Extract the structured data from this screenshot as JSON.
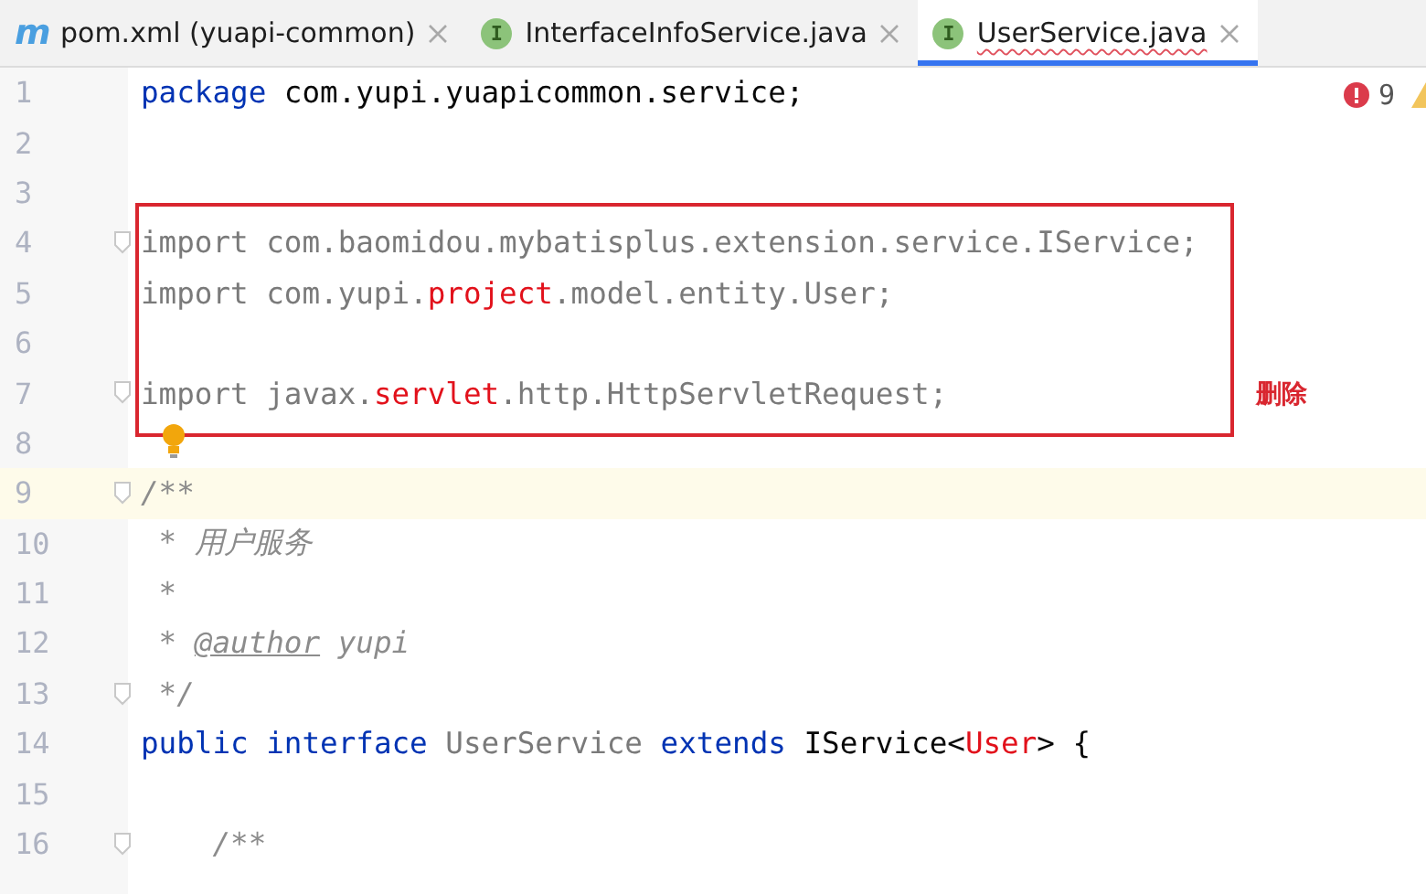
{
  "tabs": [
    {
      "badge": "m",
      "kind": "maven",
      "label": "pom.xml (yuapi-common)",
      "selected": false,
      "error": false
    },
    {
      "badge": "I",
      "kind": "interface",
      "label": "InterfaceInfoService.java",
      "selected": false,
      "error": false
    },
    {
      "badge": "I",
      "kind": "interface",
      "label": "UserService.java",
      "selected": true,
      "error": true
    }
  ],
  "inspection": {
    "errors": "9"
  },
  "lines": [
    {
      "kind": "line",
      "number": "1",
      "current": false,
      "fold": false,
      "tokens": [
        {
          "text": "package",
          "kind": "keyword"
        },
        {
          "text": " com.yupi.yuapicommon.service;",
          "kind": "plain"
        }
      ]
    },
    {
      "kind": "line",
      "number": "2",
      "current": false,
      "fold": false
    },
    {
      "kind": "line",
      "number": "3",
      "current": false,
      "fold": false
    },
    {
      "kind": "frame",
      "note": "删除",
      "children": [
        {
          "kind": "line",
          "number": "4",
          "current": false,
          "fold": true,
          "tokens": [
            {
              "text": "import com.baomidou.mybatisplus.extension.service.IService;",
              "kind": "unused"
            }
          ]
        },
        {
          "kind": "line",
          "number": "5",
          "current": false,
          "fold": false,
          "tokens": [
            {
              "text": "import com.yupi.",
              "kind": "unused"
            },
            {
              "text": "project",
              "kind": "error"
            },
            {
              "text": ".model.entity.User;",
              "kind": "unused"
            }
          ]
        },
        {
          "kind": "line",
          "number": "6",
          "current": false,
          "fold": false
        },
        {
          "kind": "line",
          "number": "7",
          "current": false,
          "fold": true,
          "tokens": [
            {
              "text": "import javax.",
              "kind": "unused"
            },
            {
              "text": "servlet",
              "kind": "error"
            },
            {
              "text": ".http.HttpServletRequest;",
              "kind": "unused"
            }
          ]
        }
      ]
    },
    {
      "kind": "line",
      "number": "8",
      "current": false,
      "fold": false,
      "bulb": true
    },
    {
      "kind": "line",
      "number": "9",
      "current": true,
      "fold": true,
      "tokens": [
        {
          "text": "/**",
          "kind": "comment"
        }
      ]
    },
    {
      "kind": "line",
      "number": "10",
      "current": false,
      "fold": false,
      "tokens": [
        {
          "text": " * 用户服务",
          "kind": "comment"
        }
      ]
    },
    {
      "kind": "line",
      "number": "11",
      "current": false,
      "fold": false,
      "tokens": [
        {
          "text": " *",
          "kind": "comment"
        }
      ]
    },
    {
      "kind": "line",
      "number": "12",
      "current": false,
      "fold": false,
      "tokens": [
        {
          "text": " * ",
          "kind": "comment"
        },
        {
          "text": "@author",
          "kind": "doctag"
        },
        {
          "text": " yupi",
          "kind": "comment"
        }
      ]
    },
    {
      "kind": "line",
      "number": "13",
      "current": false,
      "fold": true,
      "tokens": [
        {
          "text": " */",
          "kind": "comment"
        }
      ]
    },
    {
      "kind": "line",
      "number": "14",
      "current": false,
      "fold": false,
      "tokens": [
        {
          "text": "public",
          "kind": "keyword"
        },
        {
          "text": " interface",
          "kind": "keyword"
        },
        {
          "text": " UserService",
          "kind": "unused"
        },
        {
          "text": " extends",
          "kind": "keyword"
        },
        {
          "text": " IService<",
          "kind": "plain"
        },
        {
          "text": "User",
          "kind": "error"
        },
        {
          "text": "> {",
          "kind": "plain"
        }
      ]
    },
    {
      "kind": "line",
      "number": "15",
      "current": false,
      "fold": false
    },
    {
      "kind": "line",
      "number": "16",
      "current": false,
      "fold": true,
      "tokens": [
        {
          "text": "    /**",
          "kind": "comment"
        }
      ]
    }
  ]
}
